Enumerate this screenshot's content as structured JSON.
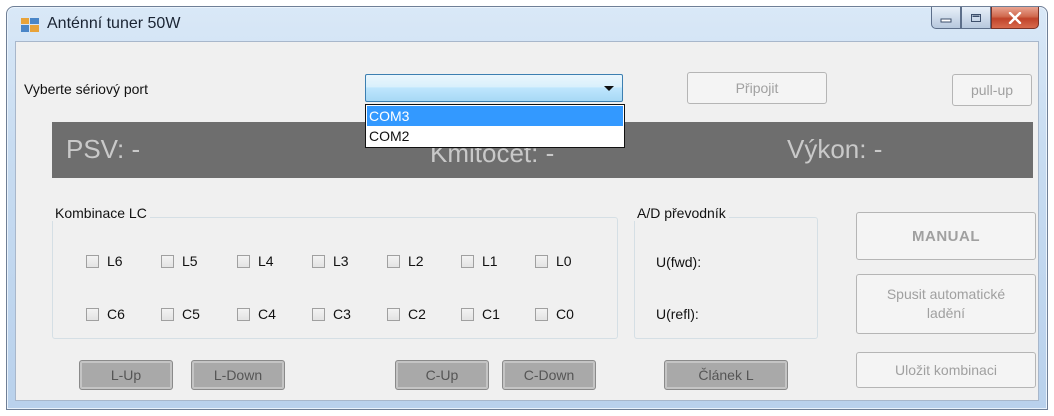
{
  "window": {
    "title": "Anténní tuner 50W",
    "controls": {
      "minimize_icon": "minimize-icon",
      "maximize_icon": "maximize-icon",
      "close_icon": "close-icon"
    }
  },
  "serial": {
    "label": "Vyberte sériový port",
    "combo_value": "",
    "dropdown_options": [
      "COM3",
      "COM2"
    ],
    "selected_option": "COM3"
  },
  "buttons": {
    "connect": "Připojit",
    "pullup": "pull-up",
    "manual": "MANUAL",
    "auto_tune": "Spusit automatické ladění",
    "save_combo": "Uložit kombinaci",
    "l_up": "L-Up",
    "l_down": "L-Down",
    "c_up": "C-Up",
    "c_down": "C-Down",
    "clanek": "Článek L"
  },
  "status": {
    "psv": "PSV:  -",
    "frequency": "Kmitočet:  -",
    "power": "Výkon:  -"
  },
  "lc_group": {
    "title": "Kombinace LC",
    "l_row": [
      "L6",
      "L5",
      "L4",
      "L3",
      "L2",
      "L1",
      "L0"
    ],
    "c_row": [
      "C6",
      "C5",
      "C4",
      "C3",
      "C2",
      "C1",
      "C0"
    ]
  },
  "ad_group": {
    "title": "A/D převodník",
    "fwd_label": "U(fwd):",
    "refl_label": "U(refl):"
  },
  "colors": {
    "status_bar_bg": "#6e6e6e",
    "status_text": "#c9c9c9",
    "selection": "#3399ff",
    "combo_border": "#3c7fb1"
  }
}
